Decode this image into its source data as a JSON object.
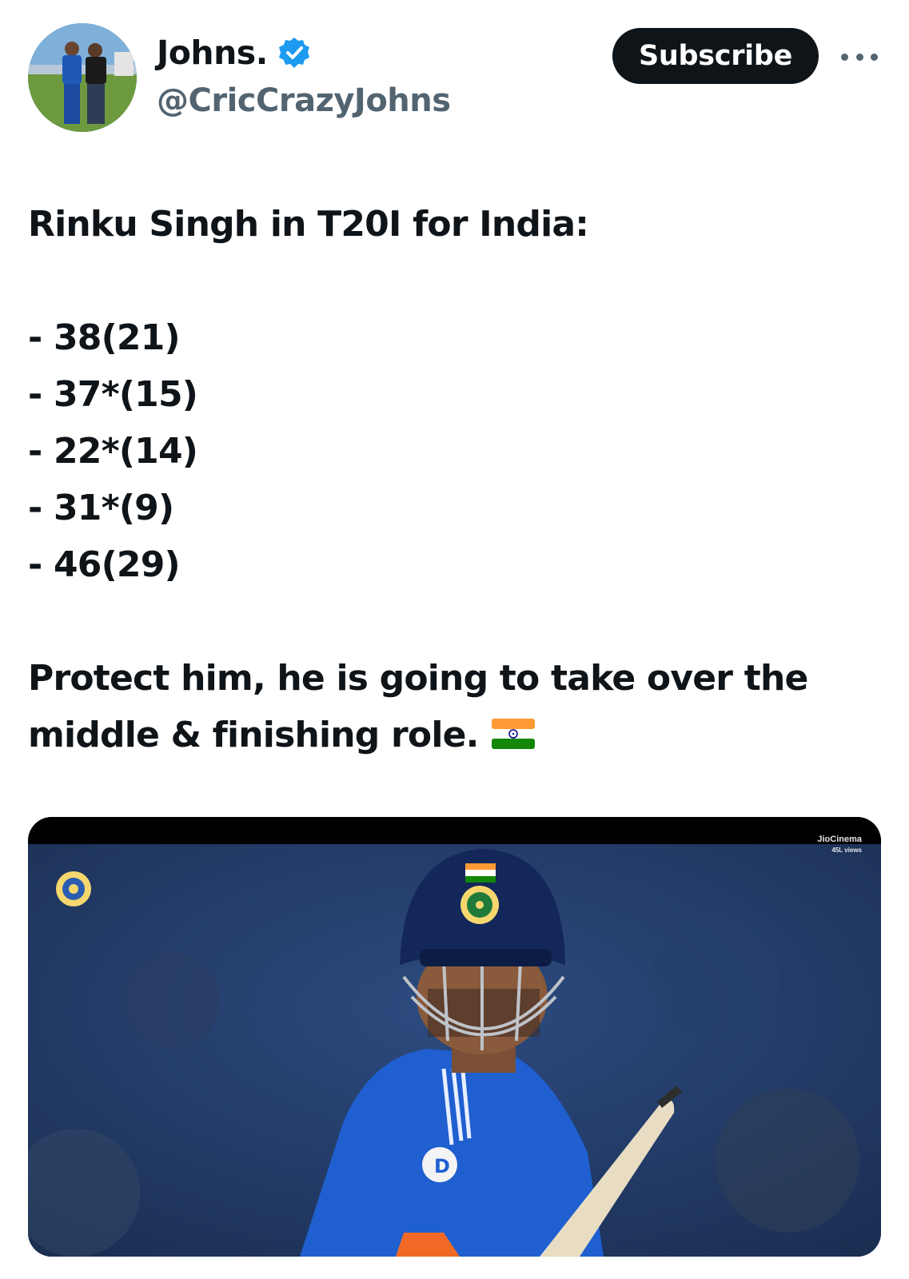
{
  "author": {
    "display_name": "Johns.",
    "handle": "@CricCrazyJohns",
    "verified": true,
    "avatar_icon": "profile-photo"
  },
  "header": {
    "subscribe_label": "Subscribe",
    "more_icon": "more-dots-icon"
  },
  "tweet": {
    "line1": "Rinku Singh in T20I for India:",
    "scores": [
      "- 38(21)",
      "- 37*(15)",
      "- 22*(14)",
      "- 31*(9)",
      "- 46(29)"
    ],
    "line2": "Protect him, he is going to take over the",
    "line3": "middle & finishing role.",
    "emoji": "india-flag-emoji"
  },
  "media": {
    "watermark_brand": "JioCinema",
    "watermark_views": "45L views"
  },
  "colors": {
    "text": "#0f1419",
    "secondary": "#536471",
    "verified_blue": "#1d9bf0",
    "button_bg": "#0f1419"
  }
}
